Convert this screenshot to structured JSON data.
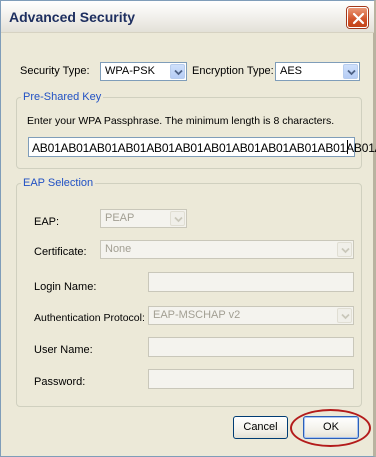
{
  "window": {
    "title": "Advanced Security"
  },
  "security": {
    "security_type_label": "Security Type:",
    "security_type_value": "WPA-PSK",
    "encryption_type_label": "Encryption Type:",
    "encryption_type_value": "AES"
  },
  "psk": {
    "group_label": "Pre-Shared Key",
    "instructions": "Enter your WPA Passphrase.  The minimum length is 8 characters.",
    "passphrase_value": "AB01AB01AB01AB01AB01AB01AB01AB01AB01AB01AB01AB01A"
  },
  "eap": {
    "group_label": "EAP Selection",
    "eap_label": "EAP:",
    "eap_value": "PEAP",
    "certificate_label": "Certificate:",
    "certificate_value": "None",
    "login_name_label": "Login Name:",
    "login_name_value": "",
    "auth_protocol_label": "Authentication Protocol:",
    "auth_protocol_value": "EAP-MSCHAP v2",
    "user_name_label": "User Name:",
    "user_name_value": "",
    "password_label": "Password:",
    "password_value": ""
  },
  "buttons": {
    "cancel_label": "Cancel",
    "ok_label": "OK"
  },
  "icons": {
    "close": "close-icon",
    "dropdown": "chevron-down-icon"
  },
  "colors": {
    "highlight": "#b31b1b",
    "group_label": "#2151c4"
  }
}
